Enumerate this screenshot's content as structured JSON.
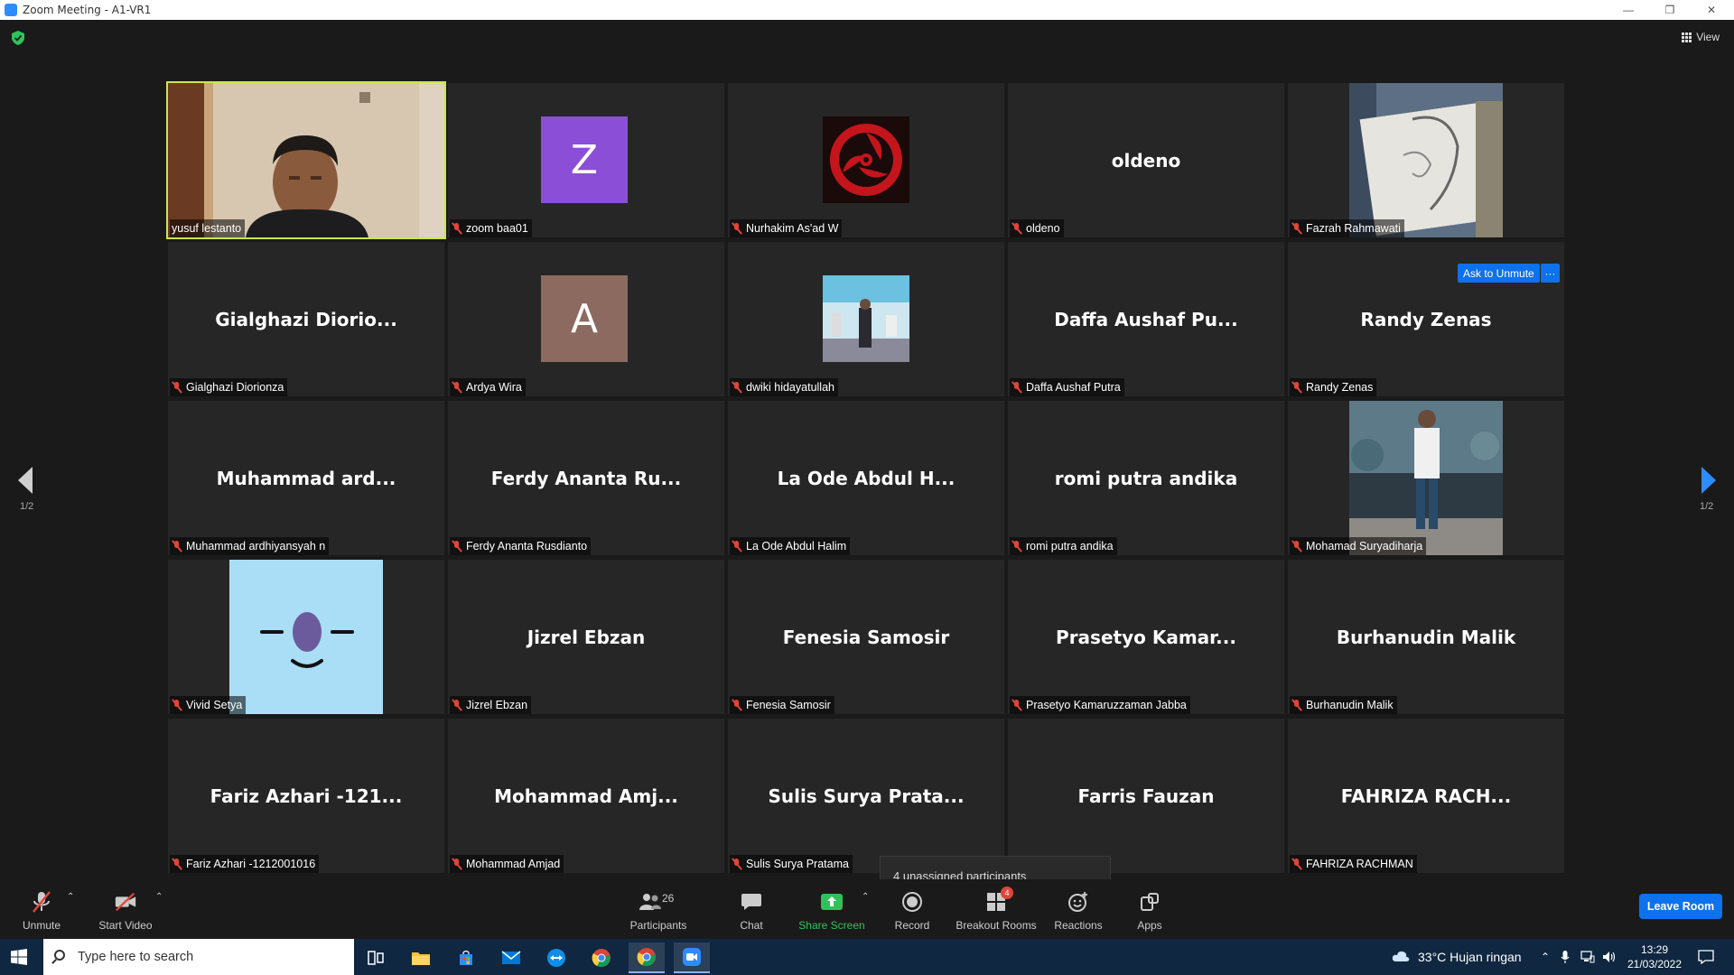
{
  "window": {
    "title": "Zoom Meeting - A1-VR1"
  },
  "header": {
    "view_label": "View"
  },
  "pagination": {
    "left": "1/2",
    "right": "1/2"
  },
  "tiles": [
    {
      "bigname": "",
      "label": "yusuf lestanto",
      "muted": false,
      "kind": "video"
    },
    {
      "bigname": "",
      "label": "zoom baa01",
      "muted": true,
      "kind": "letter",
      "letter": "Z",
      "color": "#8a4fd6"
    },
    {
      "bigname": "",
      "label": "Nurhakim As'ad W",
      "muted": true,
      "kind": "sharingan"
    },
    {
      "bigname": "oldeno",
      "label": "oldeno",
      "muted": true,
      "kind": "name"
    },
    {
      "bigname": "",
      "label": "Fazrah Rahmawati",
      "muted": true,
      "kind": "sketch"
    },
    {
      "bigname": "Gialghazi  Diorio...",
      "label": "Gialghazi Diorionza",
      "muted": true,
      "kind": "name"
    },
    {
      "bigname": "",
      "label": "Ardya Wira",
      "muted": true,
      "kind": "letter",
      "letter": "A",
      "color": "#8c6a5f"
    },
    {
      "bigname": "",
      "label": "dwiki hidayatullah",
      "muted": true,
      "kind": "photo-event"
    },
    {
      "bigname": "Daffa  Aushaf  Pu...",
      "label": "Daffa Aushaf Putra",
      "muted": true,
      "kind": "name"
    },
    {
      "bigname": "Randy Zenas",
      "label": "Randy Zenas",
      "muted": true,
      "kind": "name"
    },
    {
      "bigname": "Muhammad  ard...",
      "label": "Muhammad ardhiyansyah n",
      "muted": true,
      "kind": "name"
    },
    {
      "bigname": "Ferdy  Ananta  Ru...",
      "label": "Ferdy Ananta Rusdianto",
      "muted": true,
      "kind": "name"
    },
    {
      "bigname": "La  Ode  Abdul  H...",
      "label": "La Ode Abdul Halim",
      "muted": true,
      "kind": "name"
    },
    {
      "bigname": "romi putra andika",
      "label": "romi putra andika",
      "muted": true,
      "kind": "name"
    },
    {
      "bigname": "",
      "label": "Mohamad Suryadiharja",
      "muted": true,
      "kind": "photo-street"
    },
    {
      "bigname": "",
      "label": "Vivid Setya",
      "muted": true,
      "kind": "cartoon"
    },
    {
      "bigname": "Jizrel Ebzan",
      "label": "Jizrel Ebzan",
      "muted": true,
      "kind": "name"
    },
    {
      "bigname": "Fenesia Samosir",
      "label": "Fenesia Samosir",
      "muted": true,
      "kind": "name"
    },
    {
      "bigname": "Prasetyo  Kamar...",
      "label": "Prasetyo Kamaruzzaman Jabba",
      "muted": true,
      "kind": "name"
    },
    {
      "bigname": "Burhanudin Malik",
      "label": "Burhanudin Malik",
      "muted": true,
      "kind": "name"
    },
    {
      "bigname": "Fariz  Azhari  -121...",
      "label": "Fariz Azhari -1212001016",
      "muted": true,
      "kind": "name"
    },
    {
      "bigname": "Mohammad  Amj...",
      "label": "Mohammad Amjad",
      "muted": true,
      "kind": "name"
    },
    {
      "bigname": "Sulis  Surya  Prata...",
      "label": "Sulis Surya Pratama",
      "muted": true,
      "kind": "name"
    },
    {
      "bigname": "Farris Fauzan",
      "label": "",
      "muted": false,
      "kind": "name"
    },
    {
      "bigname": "FAHRIZA  RACH...",
      "label": "FAHRIZA RACHMAN",
      "muted": true,
      "kind": "name"
    }
  ],
  "hover_actions": {
    "ask_unmute": "Ask to Unmute",
    "more": "···"
  },
  "tooltip": {
    "text": "4 unassigned participants"
  },
  "toolbar": {
    "unmute": "Unmute",
    "start_video": "Start Video",
    "participants": "Participants",
    "participants_count": "26",
    "chat": "Chat",
    "share_screen": "Share Screen",
    "record": "Record",
    "breakout_rooms": "Breakout Rooms",
    "breakout_badge": "4",
    "reactions": "Reactions",
    "apps": "Apps",
    "leave": "Leave Room"
  },
  "taskbar": {
    "search_placeholder": "Type here to search",
    "weather": "33°C  Hujan ringan",
    "time": "13:29",
    "date": "21/03/2022"
  },
  "colors": {
    "accent": "#0e72ed",
    "active_speaker": "#c7e84c",
    "muted": "#e0453a",
    "share": "#2fc25b"
  }
}
